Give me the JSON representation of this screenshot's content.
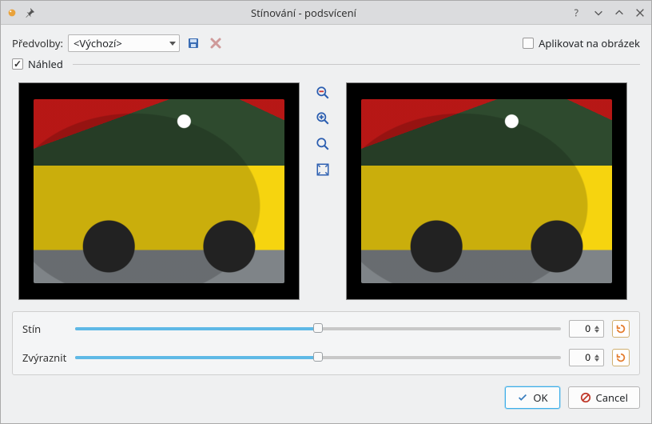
{
  "titlebar": {
    "title": "Stínování - podsvícení"
  },
  "presets": {
    "label": "Předvolby:",
    "selected": "<Výchozí>"
  },
  "apply_on_image": {
    "label": "Aplikovat na obrázek",
    "checked": false
  },
  "preview": {
    "label": "Náhled",
    "checked": true
  },
  "sliders": {
    "shadow": {
      "label": "Stín",
      "value": 0,
      "fill_pct": 50
    },
    "highlight": {
      "label": "Zvýraznit",
      "value": 0,
      "fill_pct": 50
    }
  },
  "buttons": {
    "ok": "OK",
    "cancel": "Cancel"
  },
  "colors": {
    "accent": "#3daee9",
    "slider_fill": "#5fb9e6",
    "reset_orange": "#e47b2b"
  }
}
